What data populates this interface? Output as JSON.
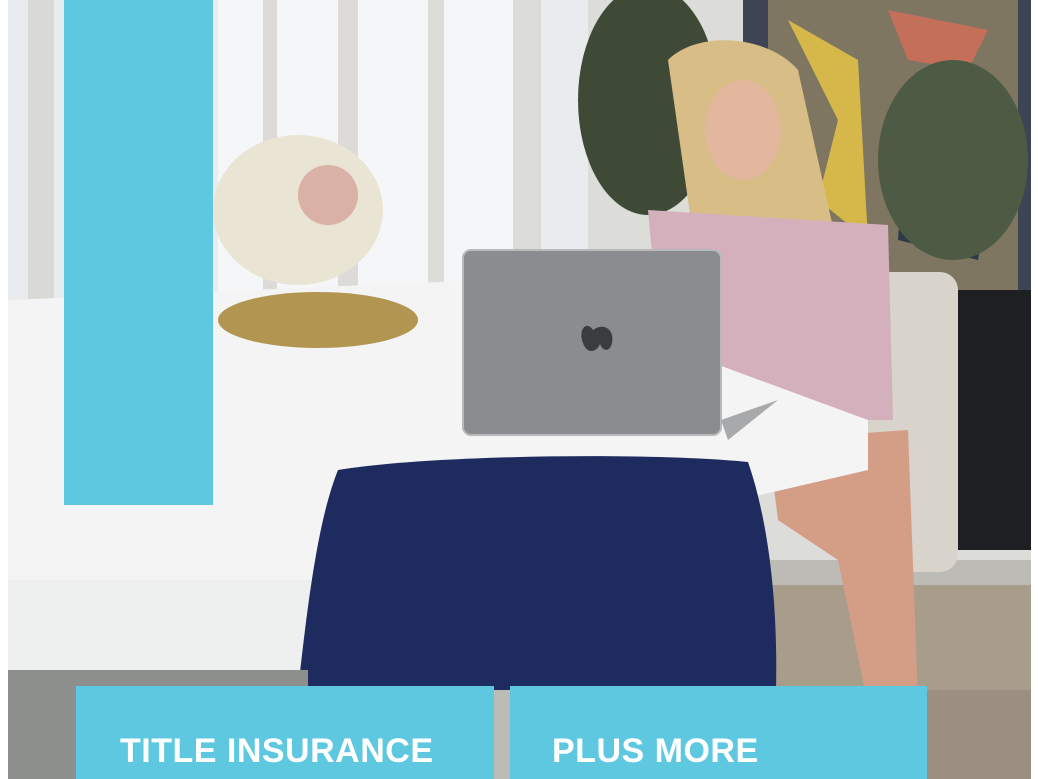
{
  "photo": {
    "subject": "woman-working-on-laptop"
  },
  "colors": {
    "accent": "#5ec8e1",
    "label_text": "#ffffff"
  },
  "labels": {
    "left": "TITLE INSURANCE",
    "right": "PLUS MORE"
  }
}
